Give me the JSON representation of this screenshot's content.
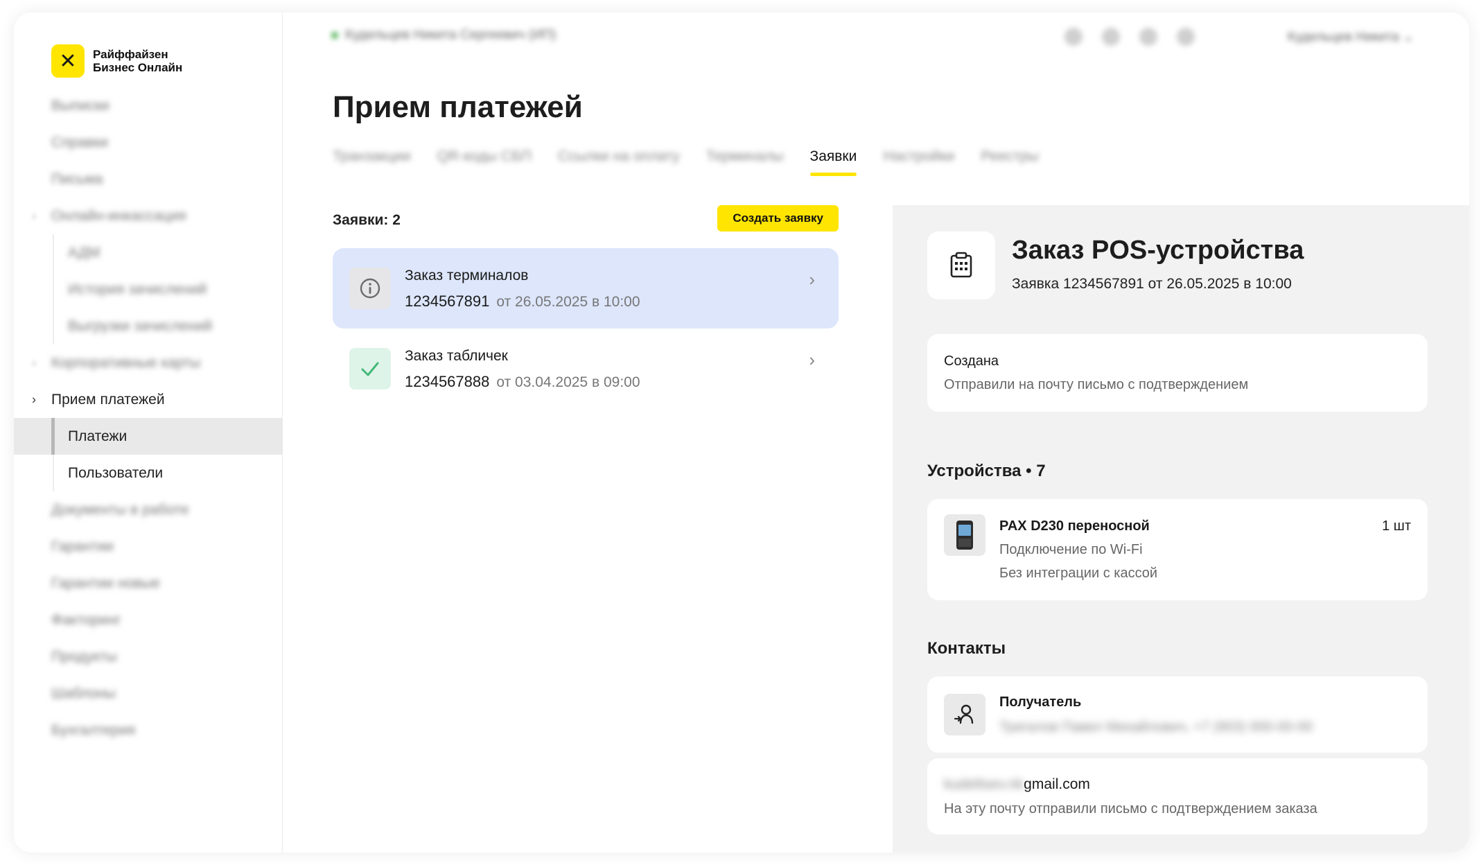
{
  "brand": {
    "line1": "Райффайзен",
    "line2": "Бизнес Онлайн",
    "mark": "✕",
    "accent": "#ffe500"
  },
  "sidebar": {
    "items": [
      {
        "label": "Выписки",
        "blurred": true
      },
      {
        "label": "Справки",
        "blurred": true
      },
      {
        "label": "Письма",
        "blurred": true
      },
      {
        "label": "Онлайн-инкассация",
        "blurred": true
      },
      {
        "label": "АДМ",
        "blurred": true
      },
      {
        "label": "История зачислений",
        "blurred": true
      },
      {
        "label": "Выгрузки зачислений",
        "blurred": true
      },
      {
        "label": "Корпоративные карты",
        "blurred": true
      },
      {
        "label": "Прием платежей"
      },
      {
        "label": "Платежи"
      },
      {
        "label": "Пользователи"
      },
      {
        "label": "Документы в работе",
        "blurred": true
      },
      {
        "label": "Гарантии",
        "blurred": true
      },
      {
        "label": "Гарантии новые",
        "blurred": true
      },
      {
        "label": "Факторинг",
        "blurred": true
      },
      {
        "label": "Продукты",
        "blurred": true
      },
      {
        "label": "Шаблоны",
        "blurred": true
      },
      {
        "label": "Бухгалтерия",
        "blurred": true
      }
    ]
  },
  "topbar": {
    "company": "Кудельцев Никита Сергеевич (ИП)",
    "user": "Кудельцев Никита"
  },
  "page": {
    "title": "Прием платежей"
  },
  "tabs": [
    {
      "label": "Транзакции",
      "blurred": true
    },
    {
      "label": "QR-коды СБП",
      "blurred": true
    },
    {
      "label": "Ссылки на оплату",
      "blurred": true
    },
    {
      "label": "Терминалы",
      "blurred": true
    },
    {
      "label": "Заявки",
      "active": true
    },
    {
      "label": "Настройки",
      "blurred": true
    },
    {
      "label": "Реестры",
      "blurred": true
    }
  ],
  "requests": {
    "count_label": "Заявки: 2",
    "create_label": "Создать заявку",
    "items": [
      {
        "title": "Заказ терминалов",
        "number": "1234567891",
        "date": "от 26.05.2025 в 10:00",
        "icon": "info-icon"
      },
      {
        "title": "Заказ табличек",
        "number": "1234567888",
        "date": "от 03.04.2025 в 09:00",
        "icon": "check-icon"
      }
    ]
  },
  "detail": {
    "title": "Заказ POS-устройства",
    "subtitle": "Заявка 1234567891 от 26.05.2025 в 10:00",
    "status": {
      "title": "Создана",
      "description": "Отправили на почту письмо с подтверждением"
    },
    "devices_title": "Устройства",
    "devices_count": "7",
    "device": {
      "name": "PAX D230 переносной",
      "qty": "1 шт",
      "line1": "Подключение по Wi-Fi",
      "line2": "Без интеграции с кассой"
    },
    "contacts_title": "Контакты",
    "recipient": {
      "title": "Получатель",
      "value": "Тригалов Павел Михайлович, +7 (903) 000-00-00"
    },
    "email": {
      "user": "kudeltsev.nk",
      "domain": "gmail.com",
      "description": "На эту почту отправили письмо с подтверждением заказа"
    }
  }
}
